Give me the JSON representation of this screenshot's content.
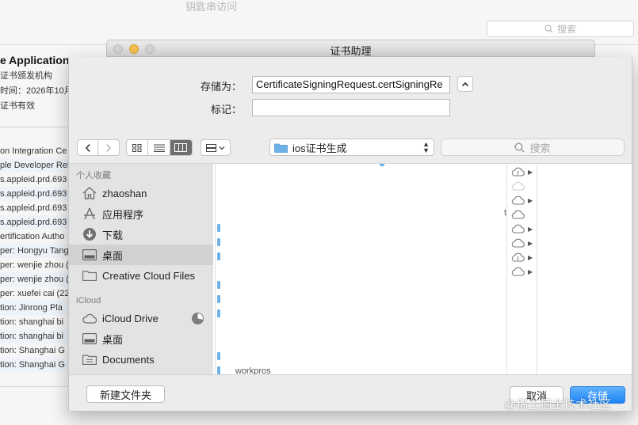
{
  "background_window": {
    "title": "钥匙串访问",
    "search_placeholder": "搜索",
    "cert_name": "e Application",
    "cert_issuer": "证书颁发机构",
    "cert_expiry": "时间：2026年10月",
    "cert_status": "证书有效",
    "list": [
      "on Integration Ce",
      "ple Developer Rela",
      "s.appleid.prd.693",
      "s.appleid.prd.693",
      "s.appleid.prd.693",
      "s.appleid.prd.693",
      "ertification Autho",
      "per: Hongyu Tang",
      "per: wenjie zhou (",
      "per: wenjie zhou (",
      "per: xuefei cai (22",
      "tion: Jinrong Pla",
      "tion: shanghai bi",
      "tion: shanghai bi",
      "tion: Shanghai G",
      "tion: Shanghai G"
    ]
  },
  "assistant_window": {
    "title": "证书助理"
  },
  "save_form": {
    "save_as_label": "存储为：",
    "save_as_value": "CertificateSigningRequest.certSigningRe",
    "tags_label": "标记：",
    "tags_value": ""
  },
  "toolbar": {
    "location": "ios证书生成",
    "search_placeholder": "搜索"
  },
  "sidebar": {
    "favorites_header": "个人收藏",
    "favorites": [
      "zhaoshan",
      "应用程序",
      "下载",
      "桌面",
      "Creative Cloud Files"
    ],
    "icloud_header": "iCloud",
    "icloud": [
      "iCloud Drive",
      "桌面",
      "Documents"
    ],
    "selected": "桌面"
  },
  "browser": {
    "fragment_text": "workpros",
    "fragment_t": "t"
  },
  "buttons": {
    "new_folder": "新建文件夹",
    "cancel": "取消",
    "save": "存储"
  },
  "watermark": "@稀土掘金技术社区",
  "colors": {
    "accent": "#1d84f5",
    "folder": "#6fb2e8",
    "sidebar_bg": "#e3e3e3",
    "sidebar_selected": "#d1d1d1",
    "minimize": "#f5bf4f"
  }
}
